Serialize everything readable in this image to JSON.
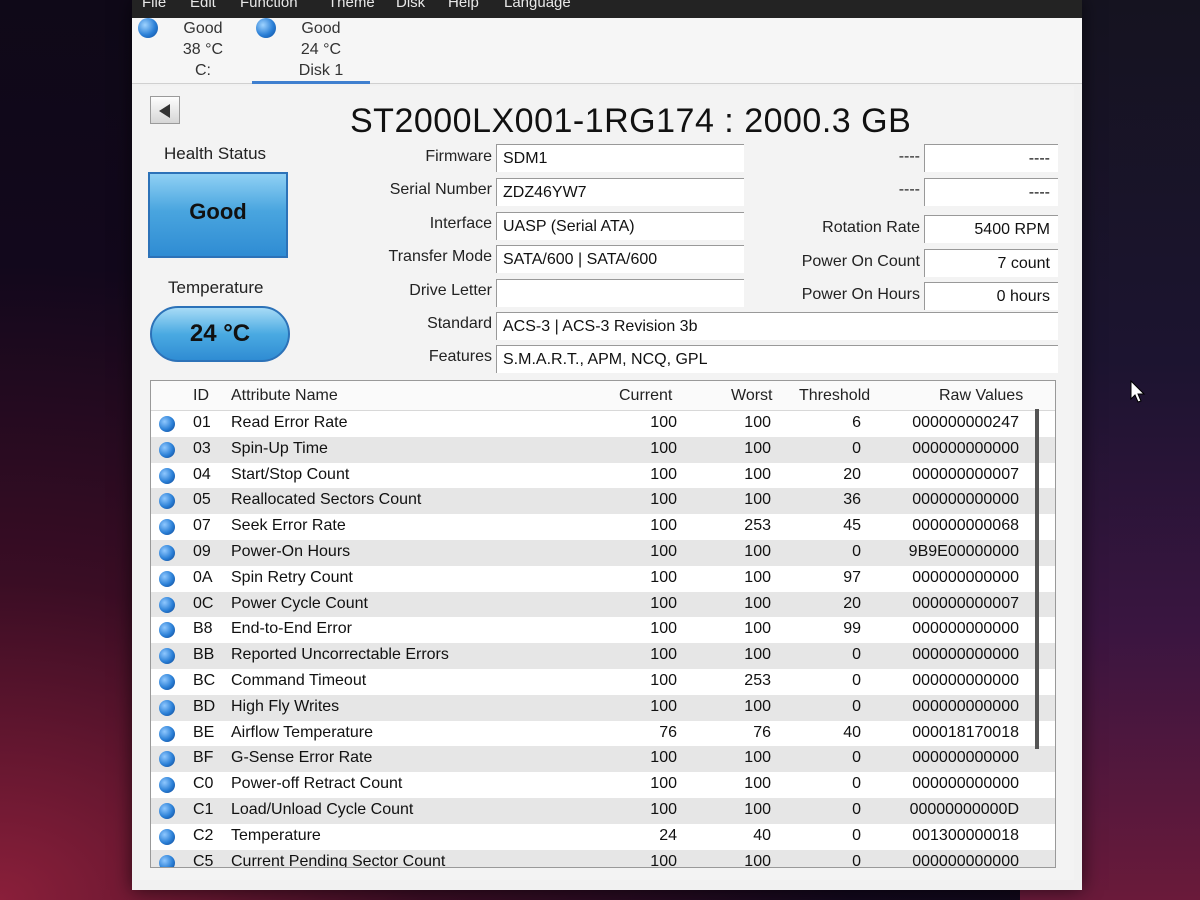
{
  "menu": [
    "File",
    "Edit",
    "Function",
    "Theme",
    "Disk",
    "Help",
    "Language"
  ],
  "disks": [
    {
      "health": "Good",
      "temp": "38 °C",
      "name": "C:"
    },
    {
      "health": "Good",
      "temp": "24 °C",
      "name": "Disk 1"
    }
  ],
  "model_title": "ST2000LX001-1RG174 : 2000.3 GB",
  "health": {
    "label": "Health Status",
    "value": "Good"
  },
  "temperature": {
    "label": "Temperature",
    "value": "24 °C"
  },
  "info": [
    {
      "label": "Firmware",
      "value": "SDM1"
    },
    {
      "label": "Serial Number",
      "value": "ZDZ46YW7"
    },
    {
      "label": "Interface",
      "value": "UASP (Serial ATA)"
    },
    {
      "label": "Transfer Mode",
      "value": "SATA/600 | SATA/600"
    },
    {
      "label": "Drive Letter",
      "value": ""
    },
    {
      "label": "Standard",
      "value": "ACS-3 | ACS-3 Revision 3b"
    },
    {
      "label": "Features",
      "value": "S.M.A.R.T., APM, NCQ, GPL"
    }
  ],
  "right_info": [
    {
      "label": "----",
      "value": "----"
    },
    {
      "label": "----",
      "value": "----"
    },
    {
      "label": "Rotation Rate",
      "value": "5400 RPM"
    },
    {
      "label": "Power On Count",
      "value": "7 count"
    },
    {
      "label": "Power On Hours",
      "value": "0 hours"
    }
  ],
  "table": {
    "columns": [
      "ID",
      "Attribute Name",
      "Current",
      "Worst",
      "Threshold",
      "Raw Values"
    ],
    "rows": [
      [
        "01",
        "Read Error Rate",
        "100",
        "100",
        "6",
        "000000000247"
      ],
      [
        "03",
        "Spin-Up Time",
        "100",
        "100",
        "0",
        "000000000000"
      ],
      [
        "04",
        "Start/Stop Count",
        "100",
        "100",
        "20",
        "000000000007"
      ],
      [
        "05",
        "Reallocated Sectors Count",
        "100",
        "100",
        "36",
        "000000000000"
      ],
      [
        "07",
        "Seek Error Rate",
        "100",
        "253",
        "45",
        "000000000068"
      ],
      [
        "09",
        "Power-On Hours",
        "100",
        "100",
        "0",
        "9B9E00000000"
      ],
      [
        "0A",
        "Spin Retry Count",
        "100",
        "100",
        "97",
        "000000000000"
      ],
      [
        "0C",
        "Power Cycle Count",
        "100",
        "100",
        "20",
        "000000000007"
      ],
      [
        "B8",
        "End-to-End Error",
        "100",
        "100",
        "99",
        "000000000000"
      ],
      [
        "BB",
        "Reported Uncorrectable Errors",
        "100",
        "100",
        "0",
        "000000000000"
      ],
      [
        "BC",
        "Command Timeout",
        "100",
        "253",
        "0",
        "000000000000"
      ],
      [
        "BD",
        "High Fly Writes",
        "100",
        "100",
        "0",
        "000000000000"
      ],
      [
        "BE",
        "Airflow Temperature",
        "76",
        "76",
        "40",
        "000018170018"
      ],
      [
        "BF",
        "G-Sense Error Rate",
        "100",
        "100",
        "0",
        "000000000000"
      ],
      [
        "C0",
        "Power-off Retract Count",
        "100",
        "100",
        "0",
        "000000000000"
      ],
      [
        "C1",
        "Load/Unload Cycle Count",
        "100",
        "100",
        "0",
        "00000000000D"
      ],
      [
        "C2",
        "Temperature",
        "24",
        "40",
        "0",
        "001300000018"
      ],
      [
        "C5",
        "Current Pending Sector Count",
        "100",
        "100",
        "0",
        "000000000000"
      ]
    ]
  },
  "colors": {
    "health_good": "#3a9ae0",
    "accent": "#3f7fcf"
  },
  "icons": {
    "back": "back-arrow-icon",
    "status": "status-dot-icon",
    "cursor": "mouse-cursor-icon"
  }
}
